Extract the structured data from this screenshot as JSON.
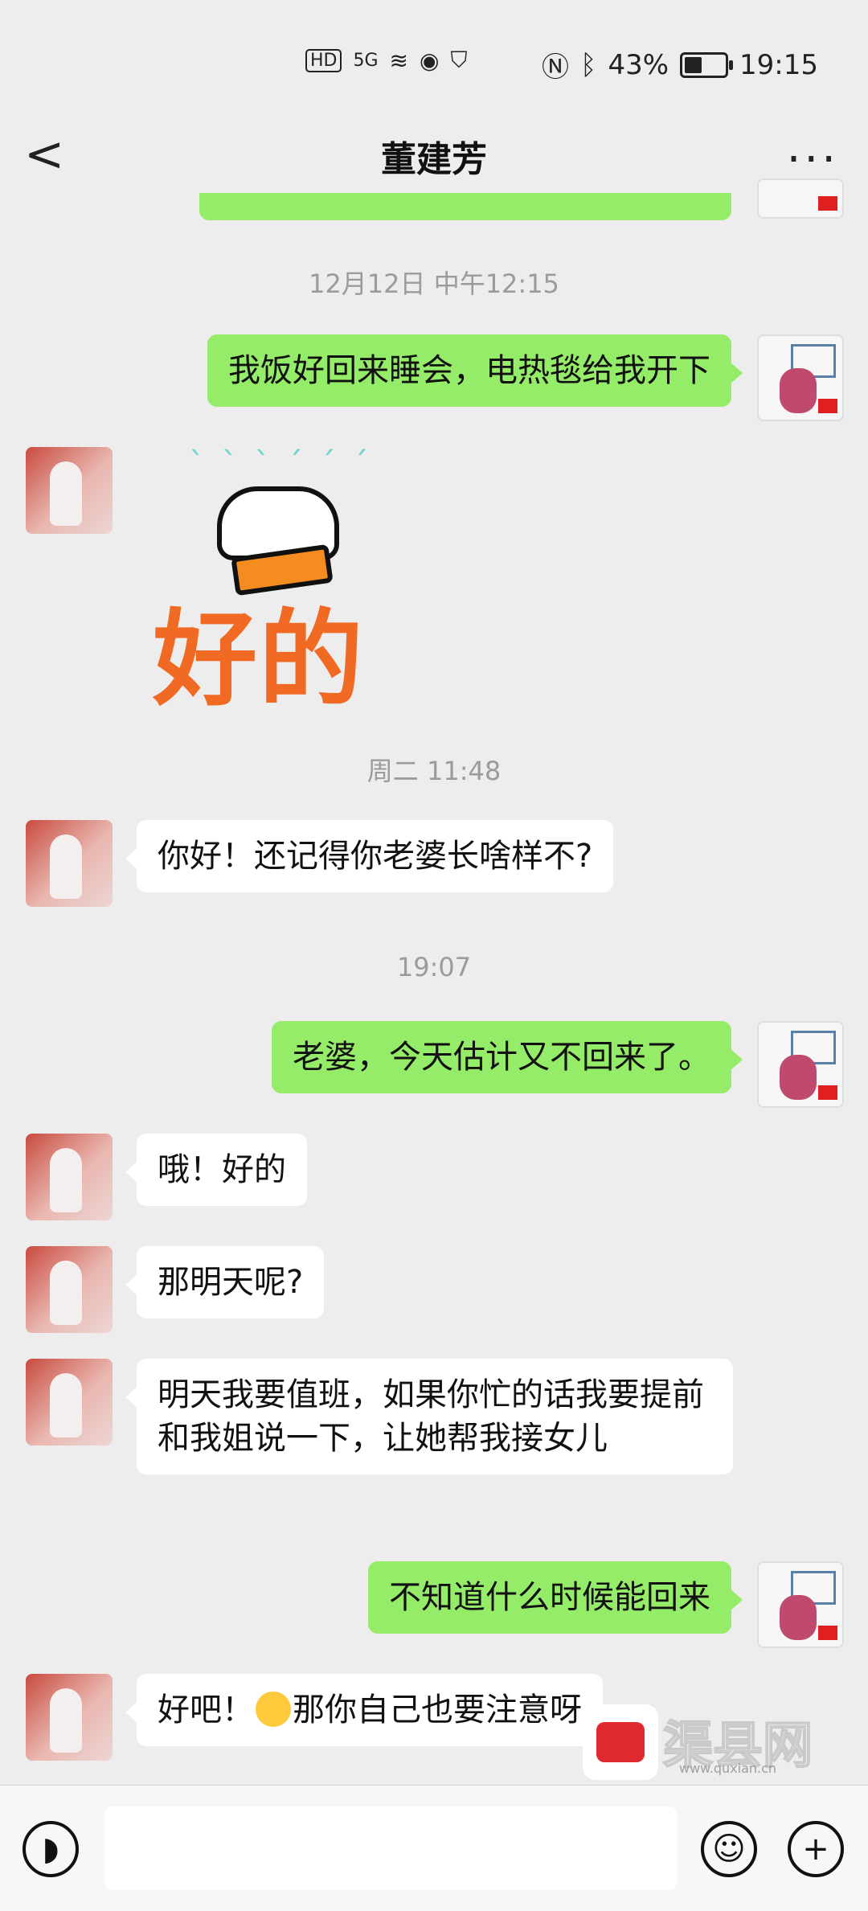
{
  "status_bar": {
    "hd": "HD",
    "signal": "5G",
    "battery": "43%",
    "battery_level": 0.43,
    "time": "19:15"
  },
  "header": {
    "back": "<",
    "title": "董建芳",
    "more": "..."
  },
  "messages": {
    "t1": "12月12日 中午12:15",
    "m1": "我饭好回来睡会，电热毯给我开下",
    "sticker": "好的",
    "t2": "周二 11:48",
    "m2": "你好！还记得你老婆长啥样不?",
    "t3": "19:07",
    "m3": "老婆，今天估计又不回来了。",
    "m4": "哦！好的",
    "m5": "那明天呢?",
    "m6": "明天我要值班，如果你忙的话我要提前和我姐说一下，让她帮我接女儿",
    "m7": "不知道什么时候能回来",
    "m8a": "好吧！",
    "m8b": "那你自己也要注意呀"
  },
  "input_bar": {
    "voice_icon": "voice-icon",
    "emoji_icon": "smile-icon",
    "plus_icon": "plus-icon"
  },
  "watermark": {
    "text": "渠县网",
    "url": "www.quxian.cn"
  }
}
